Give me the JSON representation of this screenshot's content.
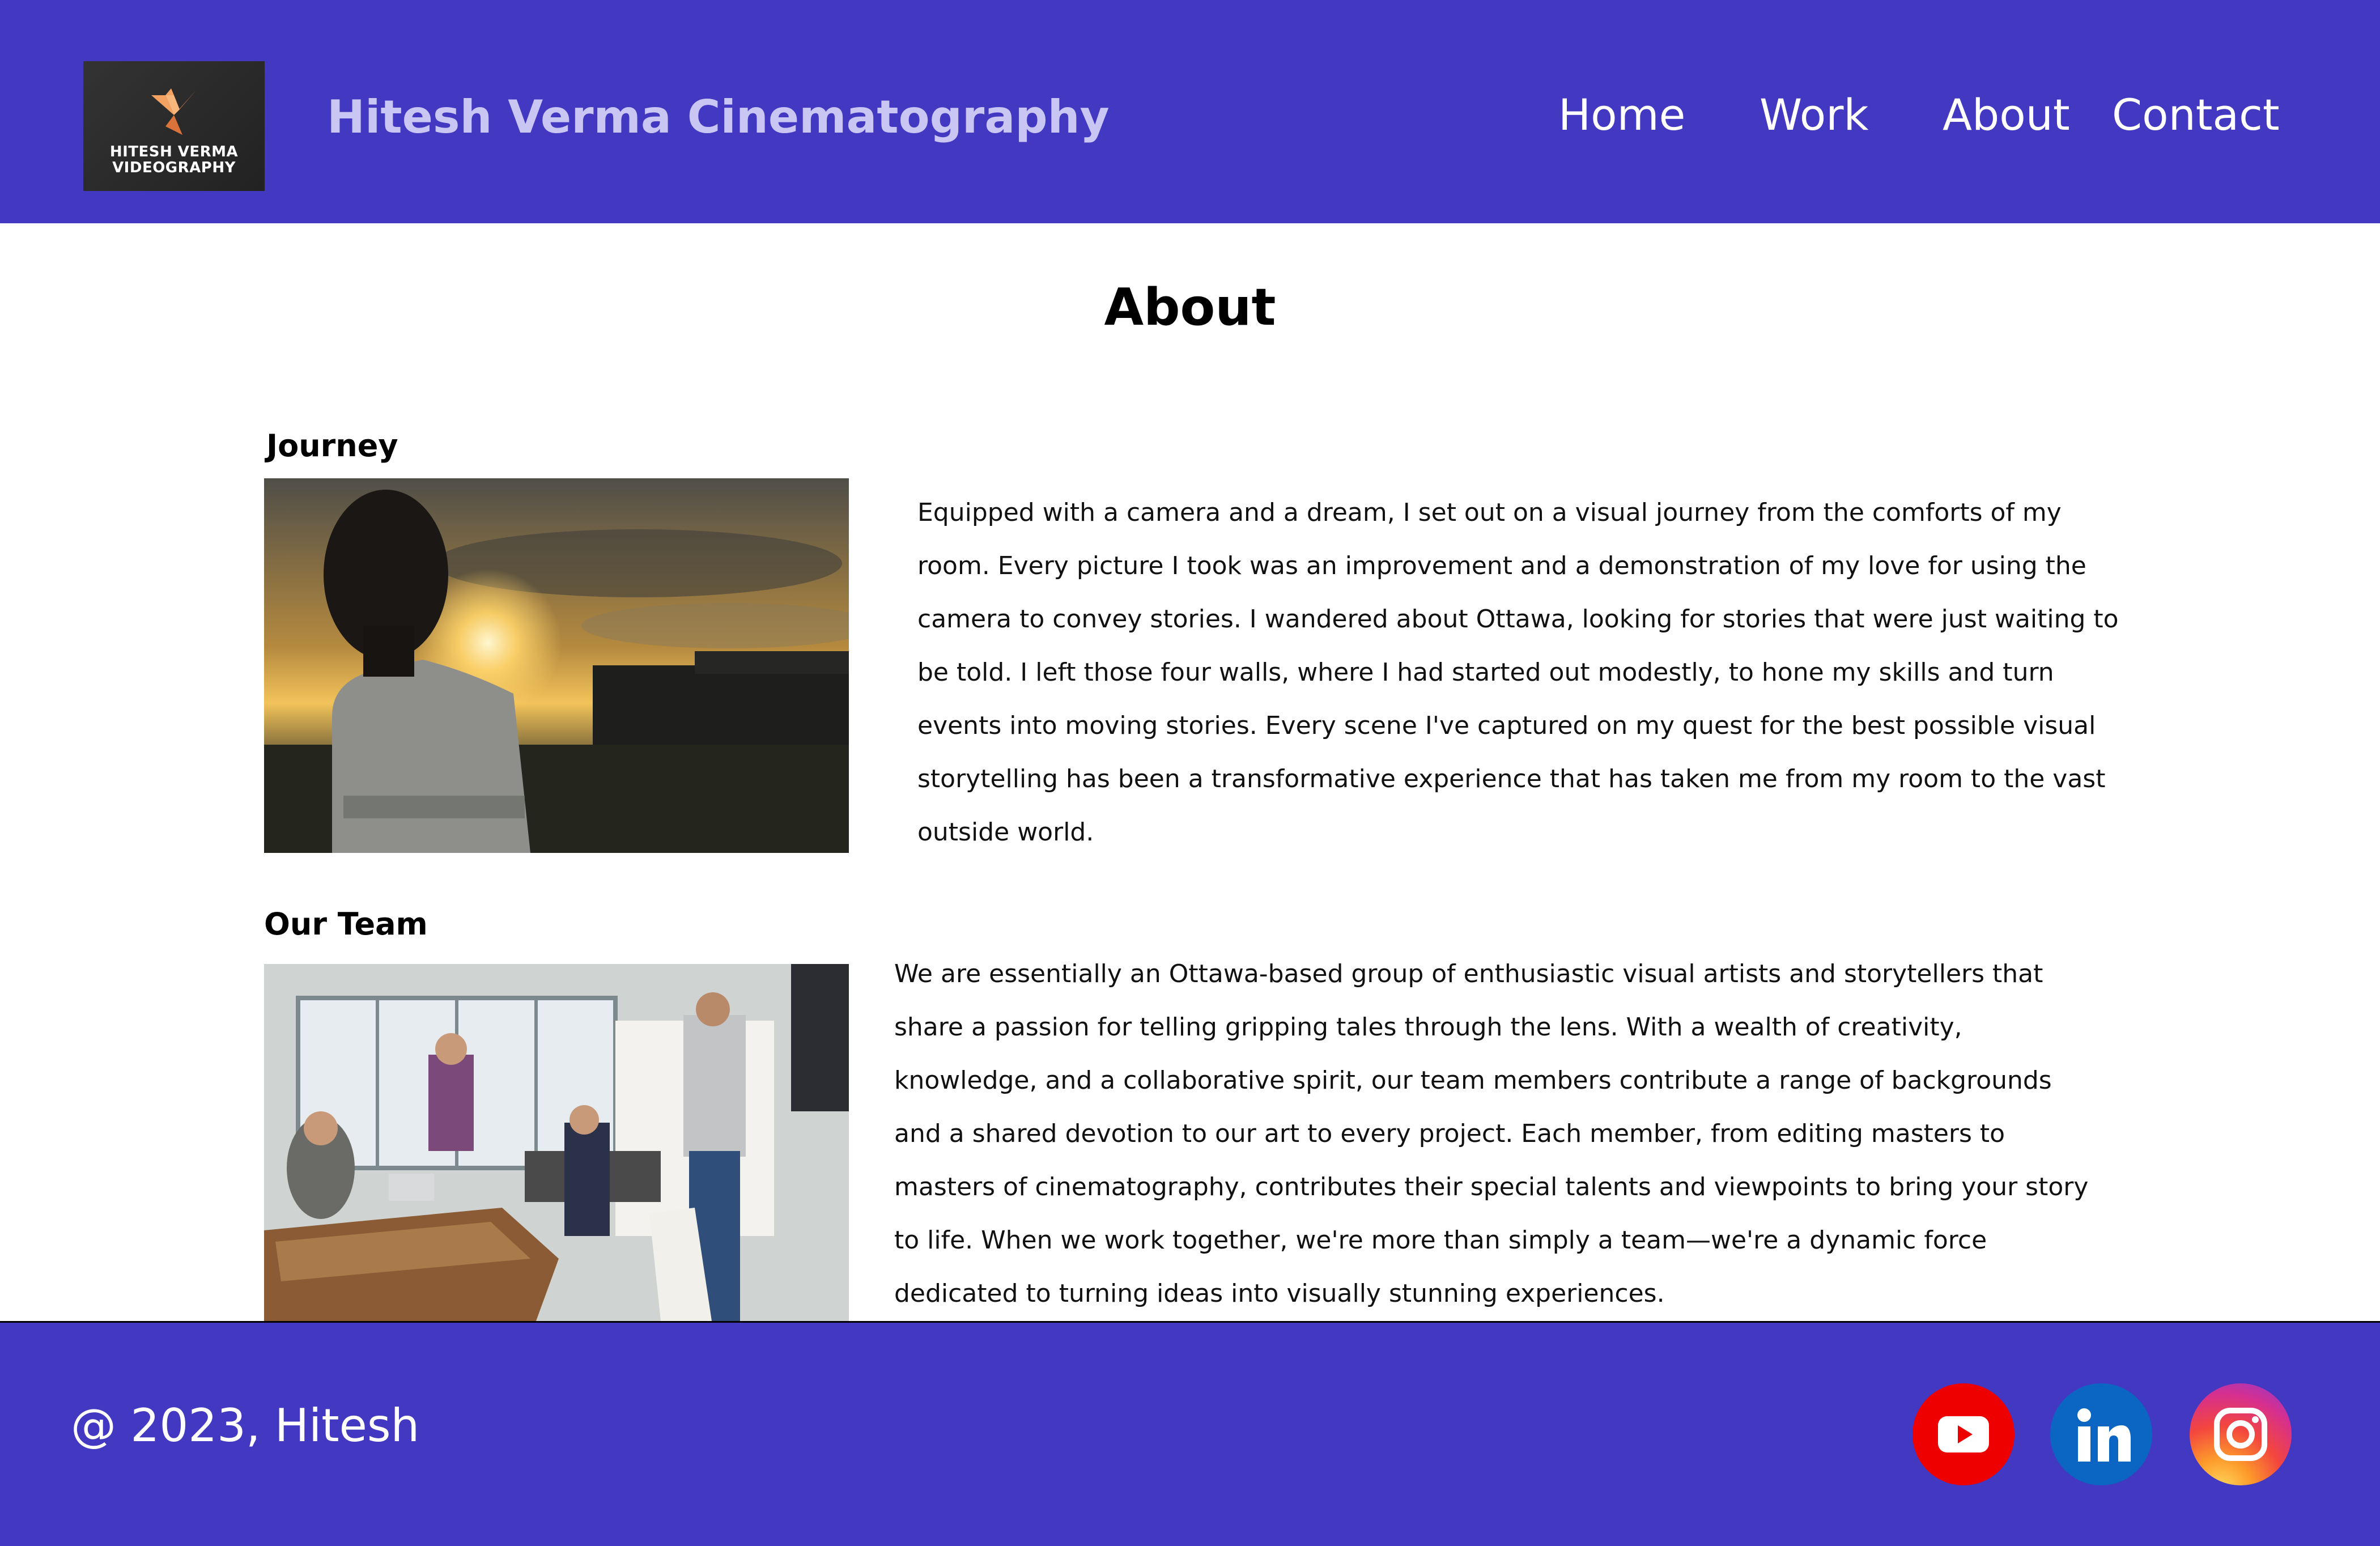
{
  "header": {
    "logo_text_line1": "HITESH VERMA",
    "logo_text_line2": "VIDEOGRAPHY",
    "site_title": "Hitesh Verma Cinematography",
    "nav": {
      "home": "Home",
      "work": "Work",
      "about": "About",
      "contact": "Contact"
    }
  },
  "main": {
    "heading": "About",
    "journey": {
      "title": "Journey",
      "text": "Equipped with a camera and a dream, I set out on a visual journey from the comforts of my room. Every picture I took was an improvement and a demonstration of my love for using the camera to convey stories. I wandered about Ottawa, looking for stories that were just waiting to be told. I left those four walls, where I had started out modestly, to hone my skills and turn events into moving stories. Every scene I've captured on my quest for the best possible visual storytelling has been a transformative experience that has taken me from my room to the vast outside world."
    },
    "team": {
      "title": "Our Team",
      "text": "We are essentially an Ottawa-based group of enthusiastic visual artists and storytellers that share a passion for telling gripping tales through the lens. With a wealth of creativity, knowledge, and a collaborative spirit, our team members contribute a range of backgrounds and a shared devotion to our art to every project. Each member, from editing masters to masters of cinematography, contributes their special talents and viewpoints to bring your story to life. When we work together, we're more than simply a team—we're a dynamic force dedicated to turning ideas into visually stunning experiences."
    }
  },
  "footer": {
    "copyright": "@ 2023, Hitesh",
    "social": [
      "youtube-icon",
      "linkedin-icon",
      "instagram-icon"
    ]
  },
  "colors": {
    "brand_purple": "#4338c2",
    "title_lavender": "#c9c6f3",
    "youtube_red": "#ee0000",
    "linkedin_blue": "#0a66c2"
  }
}
